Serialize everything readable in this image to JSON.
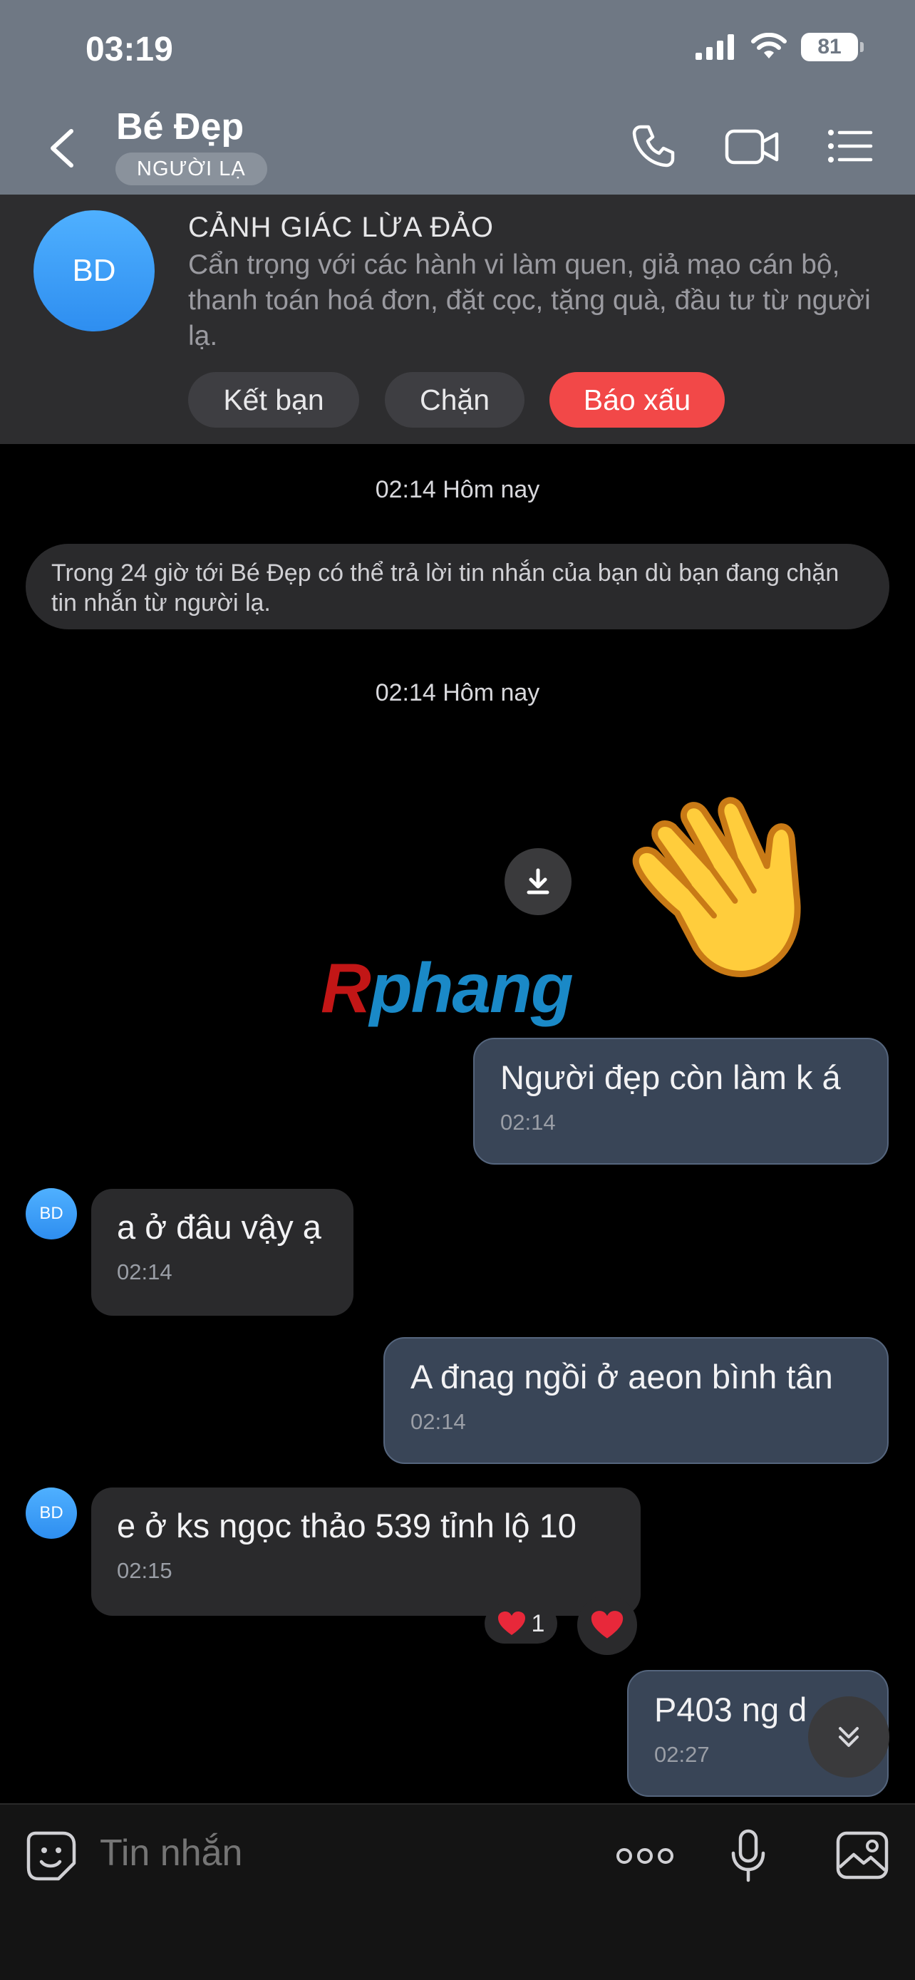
{
  "status_bar": {
    "time": "03:19",
    "battery": "81"
  },
  "header": {
    "title": "Bé Đẹp",
    "badge": "NGƯỜI LẠ",
    "icons": [
      "back-icon",
      "phone-icon",
      "video-icon",
      "menu-icon"
    ]
  },
  "banner": {
    "avatar": "BD",
    "title": "CẢNH GIÁC LỪA ĐẢO",
    "text": "Cẩn trọng với các hành vi làm quen, giả mạo cán bộ, thanh toán hoá đơn, đặt cọc, tặng quà, đầu tư từ người lạ.",
    "buttons": {
      "add_friend": "Kết bạn",
      "block": "Chặn",
      "report": "Báo xấu"
    }
  },
  "chat": {
    "timestamp_1": "02:14 Hôm nay",
    "notice": "Trong 24 giờ tới Bé Đẹp có thể trả lời tin nhắn của bạn dù bạn đang chặn tin nhắn từ người lạ.",
    "timestamp_2": "02:14 Hôm nay",
    "watermark_r": "R",
    "watermark_rest": "phang",
    "messages": [
      {
        "side": "out",
        "text": "Người đẹp còn làm k á",
        "time": "02:14"
      },
      {
        "side": "in",
        "avatar": "BD",
        "text": "a ở đâu vậy ạ",
        "time": "02:14"
      },
      {
        "side": "out",
        "text": "A đnag ngồi ở aeon bình tân",
        "time": "02:14"
      },
      {
        "side": "in",
        "avatar": "BD",
        "text": "e ở ks ngọc thảo 539 tỉnh lộ 10",
        "time": "02:15",
        "reaction_count": "1"
      },
      {
        "side": "out",
        "text": "P403 ng d",
        "time": "02:27"
      }
    ]
  },
  "input": {
    "placeholder": "Tin nhắn"
  },
  "colors": {
    "header_bg": "#6f7884",
    "report_red": "#f24848",
    "out_bubble": "#394557",
    "in_bubble": "#2a2a2c",
    "avatar_blue": "#3a9cf5"
  }
}
